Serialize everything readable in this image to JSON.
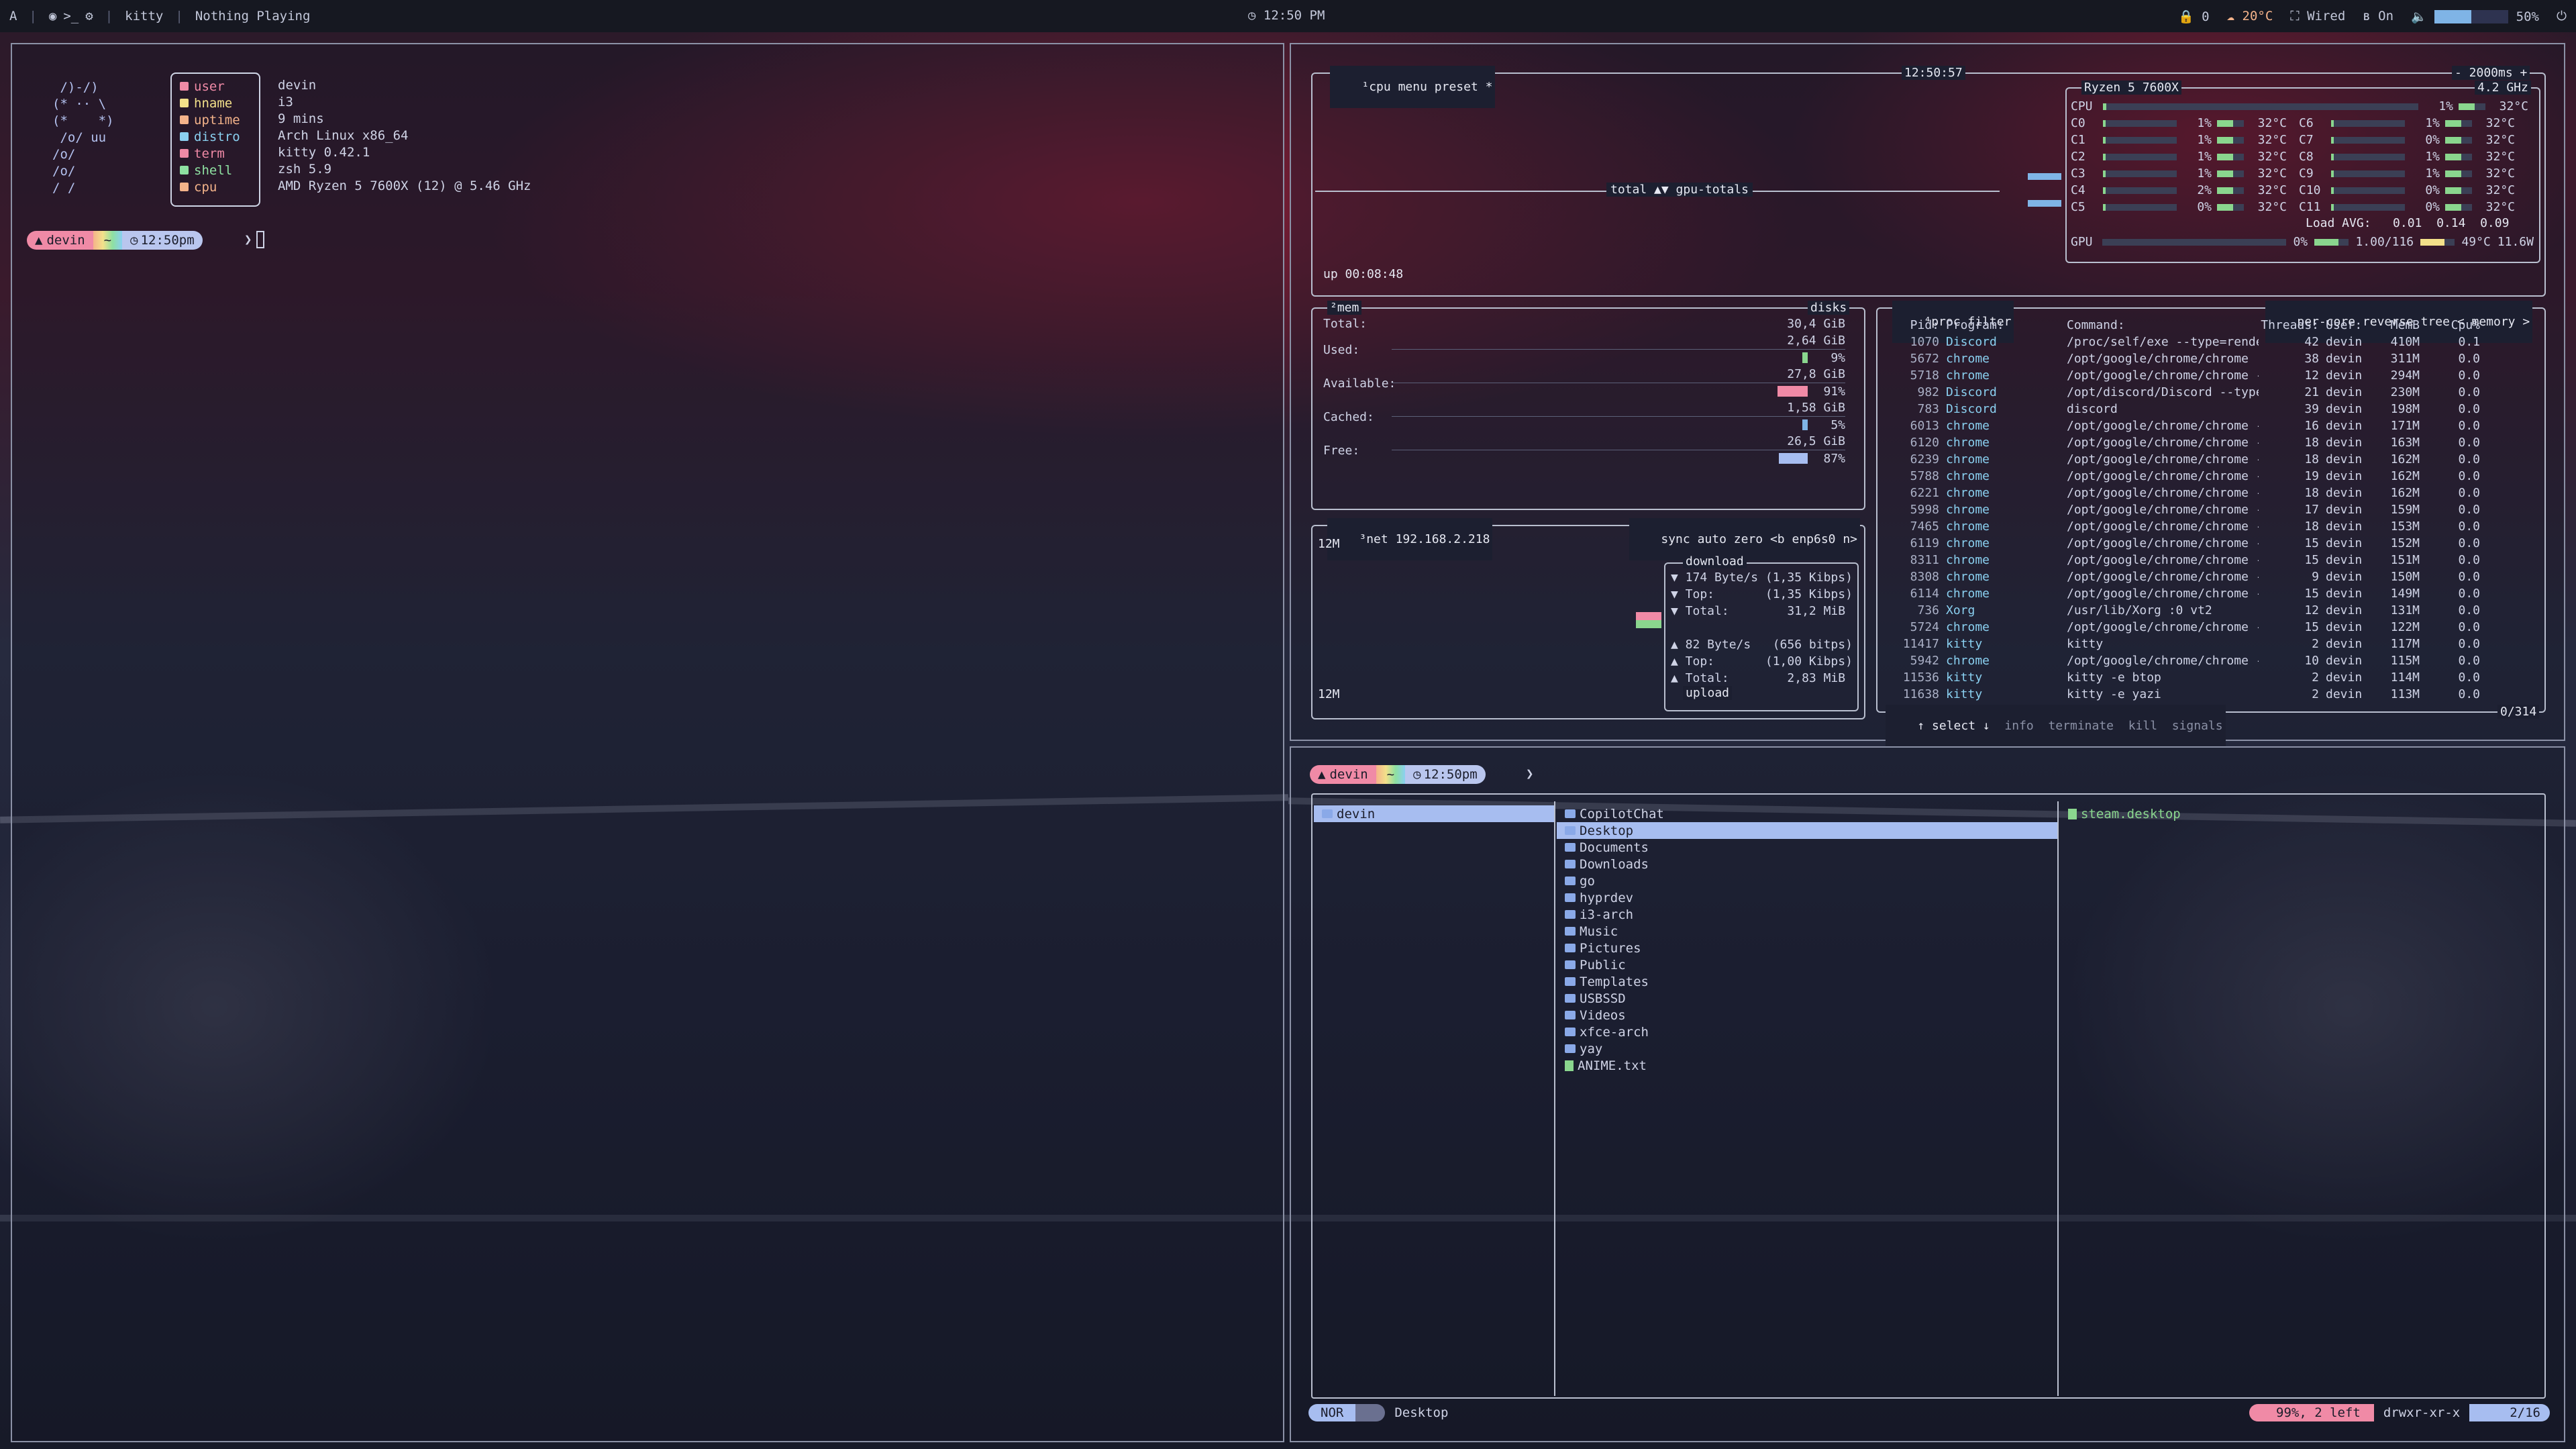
{
  "topbar": {
    "left": {
      "workspace_glyph": "A",
      "app_terminal": "kitty",
      "media": "Nothing Playing"
    },
    "clock": "12:50 PM",
    "right": {
      "notifications": "0",
      "weather": "20°C",
      "network": "Wired",
      "bluetooth": "On",
      "volume": "50%",
      "volume_level": 0.5
    }
  },
  "fetch": {
    "ascii": [
      " /)-/)",
      "(* ·· \\",
      "(*    *)",
      " /o/ uu",
      "/o/",
      "/o/",
      "/ /"
    ],
    "labels": [
      "user",
      "hname",
      "uptime",
      "distro",
      "term",
      "shell",
      "cpu"
    ],
    "label_colors": [
      "#f08aa6",
      "#f3e08a",
      "#f4b38a",
      "#8ad0f0",
      "#f08aa6",
      "#8ee0a1",
      "#f4b38a"
    ],
    "values": [
      "devin",
      "i3",
      "9 mins",
      "Arch Linux x86_64",
      "kitty 0.42.1",
      "zsh 5.9",
      "AMD Ryzen 5 7600X (12) @ 5.46 GHz"
    ]
  },
  "prompt": {
    "user": "devin",
    "dir": "~",
    "time": "12:50pm",
    "arrow": "❯"
  },
  "btop": {
    "cpu_box": {
      "tabs": [
        "¹cpu",
        "menu",
        "preset *"
      ],
      "clock": "12:50:57",
      "interval": "- 2000ms +",
      "graph_label": "total ▲▼ gpu-totals",
      "uptime": "up 00:08:48",
      "cpu_model": "Ryzen 5 7600X",
      "freq": "4.2 GHz",
      "cpu_total": {
        "name": "CPU",
        "pct": "1%",
        "temp": "32°C"
      },
      "cores_left": [
        {
          "name": "C0",
          "pct": "1%",
          "temp": "32°C"
        },
        {
          "name": "C1",
          "pct": "1%",
          "temp": "32°C"
        },
        {
          "name": "C2",
          "pct": "1%",
          "temp": "32°C"
        },
        {
          "name": "C3",
          "pct": "1%",
          "temp": "32°C"
        },
        {
          "name": "C4",
          "pct": "2%",
          "temp": "32°C"
        },
        {
          "name": "C5",
          "pct": "0%",
          "temp": "32°C"
        }
      ],
      "cores_right": [
        {
          "name": "C6",
          "pct": "1%",
          "temp": "32°C"
        },
        {
          "name": "C7",
          "pct": "0%",
          "temp": "32°C"
        },
        {
          "name": "C8",
          "pct": "1%",
          "temp": "32°C"
        },
        {
          "name": "C9",
          "pct": "1%",
          "temp": "32°C"
        },
        {
          "name": "C10",
          "pct": "0%",
          "temp": "32°C"
        },
        {
          "name": "C11",
          "pct": "0%",
          "temp": "32°C"
        }
      ],
      "load_avg": "Load AVG:   0.01  0.14  0.09",
      "gpu": {
        "name": "GPU",
        "pct": "0%",
        "mem": "1.00/116",
        "temp": "49°C",
        "extra": "11.6W"
      }
    },
    "mem_box": {
      "title": "²mem",
      "disks": "disks",
      "rows": [
        {
          "label": "Total:",
          "value": "30,4 GiB",
          "pct": ""
        },
        {
          "label": "Used:",
          "value": "2,64 GiB",
          "pct": "9%"
        },
        {
          "label": "Available:",
          "value": "27,8 GiB",
          "pct": "91%"
        },
        {
          "label": "Cached:",
          "value": "1,58 GiB",
          "pct": "5%"
        },
        {
          "label": "Free:",
          "value": "26,5 GiB",
          "pct": "87%"
        }
      ],
      "bar_colors": [
        "#8ad68e",
        "#f08aa6",
        "#7fb4e6",
        "#a7bdf0"
      ]
    },
    "net_box": {
      "title": "³net",
      "ip": "192.168.2.218",
      "options": [
        "sync",
        "auto",
        "zero",
        "<b enp6s0 n>"
      ],
      "scale_top": "12M",
      "scale_bottom": "12M",
      "download_label": "download",
      "download": [
        "▼ 174 Byte/s (1,35 Kibps)",
        "▼ Top:       (1,35 Kibps)",
        "▼ Total:        31,2 MiB"
      ],
      "upload": [
        "▲ 82 Byte/s   (656 bitps)",
        "▲ Top:       (1,00 Kibps)",
        "▲ Total:        2,83 MiB"
      ],
      "upload_label": "upload"
    },
    "proc_box": {
      "title": "⁴proc",
      "filter": "filter",
      "options": [
        "per-core",
        "reverse",
        "tree",
        "< memory >"
      ],
      "headers": [
        "Pid:",
        "Program:",
        "Command:",
        "Threads:",
        "User:",
        "MemB",
        "Cpu%"
      ],
      "rows": [
        [
          "1070",
          "Discord",
          "/proc/self/exe --type=rendere",
          "42",
          "devin",
          "410M",
          "0.1"
        ],
        [
          "5672",
          "chrome",
          "/opt/google/chrome/chrome",
          "38",
          "devin",
          "311M",
          "0.0"
        ],
        [
          "5718",
          "chrome",
          "/opt/google/chrome/chrome --t",
          "12",
          "devin",
          "294M",
          "0.0"
        ],
        [
          "982",
          "Discord",
          "/opt/discord/Discord --type=z",
          "21",
          "devin",
          "230M",
          "0.0"
        ],
        [
          "783",
          "Discord",
          "discord",
          "39",
          "devin",
          "198M",
          "0.0"
        ],
        [
          "6013",
          "chrome",
          "/opt/google/chrome/chrome --t",
          "16",
          "devin",
          "171M",
          "0.0"
        ],
        [
          "6120",
          "chrome",
          "/opt/google/chrome/chrome --t",
          "18",
          "devin",
          "163M",
          "0.0"
        ],
        [
          "6239",
          "chrome",
          "/opt/google/chrome/chrome --t",
          "18",
          "devin",
          "162M",
          "0.0"
        ],
        [
          "5788",
          "chrome",
          "/opt/google/chrome/chrome --t",
          "19",
          "devin",
          "162M",
          "0.0"
        ],
        [
          "6221",
          "chrome",
          "/opt/google/chrome/chrome --t",
          "18",
          "devin",
          "162M",
          "0.0"
        ],
        [
          "5998",
          "chrome",
          "/opt/google/chrome/chrome --t",
          "17",
          "devin",
          "159M",
          "0.0"
        ],
        [
          "7465",
          "chrome",
          "/opt/google/chrome/chrome --t",
          "18",
          "devin",
          "153M",
          "0.0"
        ],
        [
          "6119",
          "chrome",
          "/opt/google/chrome/chrome --t",
          "15",
          "devin",
          "152M",
          "0.0"
        ],
        [
          "8311",
          "chrome",
          "/opt/google/chrome/chrome --t",
          "15",
          "devin",
          "151M",
          "0.0"
        ],
        [
          "8308",
          "chrome",
          "/opt/google/chrome/chrome --t",
          "9",
          "devin",
          "150M",
          "0.0"
        ],
        [
          "6114",
          "chrome",
          "/opt/google/chrome/chrome --t",
          "15",
          "devin",
          "149M",
          "0.0"
        ],
        [
          "736",
          "Xorg",
          "/usr/lib/Xorg :0 vt2",
          "12",
          "devin",
          "131M",
          "0.0"
        ],
        [
          "5724",
          "chrome",
          "/opt/google/chrome/chrome --t",
          "15",
          "devin",
          "122M",
          "0.0"
        ],
        [
          "11417",
          "kitty",
          "kitty",
          "2",
          "devin",
          "117M",
          "0.0"
        ],
        [
          "5942",
          "chrome",
          "/opt/google/chrome/chrome --t",
          "10",
          "devin",
          "115M",
          "0.0"
        ],
        [
          "11536",
          "kitty",
          "kitty -e btop",
          "2",
          "devin",
          "114M",
          "0.0"
        ],
        [
          "11638",
          "kitty",
          "kitty -e yazi",
          "2",
          "devin",
          "113M",
          "0.0"
        ]
      ],
      "footer": [
        "↑ select ↓",
        "info",
        "terminate",
        "kill",
        "signals"
      ],
      "count": "0/314"
    }
  },
  "files": {
    "parent": [
      "devin"
    ],
    "current": [
      {
        "name": "CopilotChat",
        "kind": "folder"
      },
      {
        "name": "Desktop",
        "kind": "folder",
        "selected": true
      },
      {
        "name": "Documents",
        "kind": "folder"
      },
      {
        "name": "Downloads",
        "kind": "folder"
      },
      {
        "name": "go",
        "kind": "folder"
      },
      {
        "name": "hyprdev",
        "kind": "folder"
      },
      {
        "name": "i3-arch",
        "kind": "folder"
      },
      {
        "name": "Music",
        "kind": "folder"
      },
      {
        "name": "Pictures",
        "kind": "folder"
      },
      {
        "name": "Public",
        "kind": "folder"
      },
      {
        "name": "Templates",
        "kind": "folder"
      },
      {
        "name": "USBSSD",
        "kind": "folder"
      },
      {
        "name": "Videos",
        "kind": "folder"
      },
      {
        "name": "xfce-arch",
        "kind": "folder"
      },
      {
        "name": "yay",
        "kind": "folder"
      },
      {
        "name": "ANIME.txt",
        "kind": "file"
      }
    ],
    "preview": [
      "steam.desktop"
    ],
    "status": {
      "mode": "NOR",
      "path": "Desktop",
      "disk": "99%, 2 left",
      "perms": "drwxr-xr-x",
      "position": "2/16"
    }
  }
}
